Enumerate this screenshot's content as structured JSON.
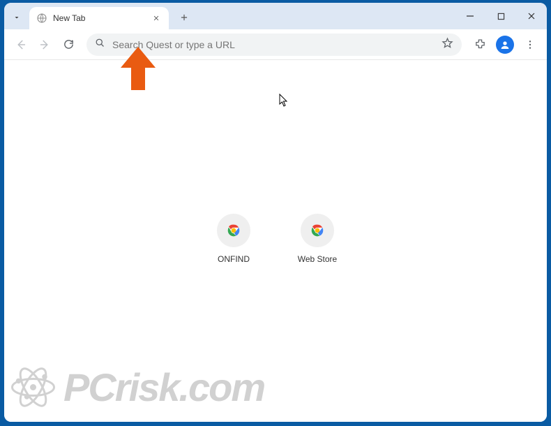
{
  "tab": {
    "title": "New Tab"
  },
  "omnibox": {
    "placeholder": "Search Quest or type a URL"
  },
  "shortcuts": [
    {
      "label": "ONFIND"
    },
    {
      "label": "Web Store"
    }
  ],
  "watermark": {
    "text": "PCrisk.com"
  },
  "colors": {
    "frame": "#0a5ba3",
    "tabstrip": "#dde7f4",
    "omnibox_bg": "#f1f3f4",
    "profile": "#1a73e8",
    "arrow": "#e95b11"
  }
}
